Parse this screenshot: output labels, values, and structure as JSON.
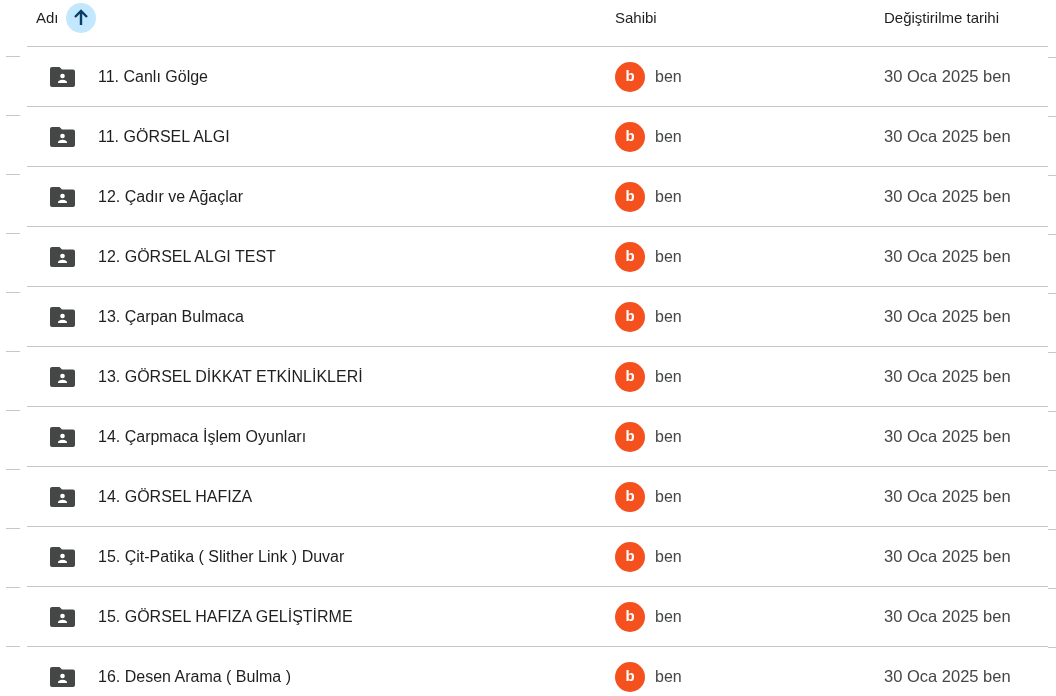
{
  "columns": [
    {
      "label": "Adı",
      "sorted": true
    },
    {
      "label": "Sahibi",
      "sorted": false
    },
    {
      "label": "Değiştirilme tarihi",
      "sorted": false
    }
  ],
  "rows": [
    {
      "name": "11. Canlı Gölge",
      "owner_initial": "b",
      "owner": "ben",
      "modified": "30 Oca 2025 ben"
    },
    {
      "name": "11. GÖRSEL ALGI",
      "owner_initial": "b",
      "owner": "ben",
      "modified": "30 Oca 2025 ben"
    },
    {
      "name": "12. Çadır ve Ağaçlar",
      "owner_initial": "b",
      "owner": "ben",
      "modified": "30 Oca 2025 ben"
    },
    {
      "name": "12. GÖRSEL ALGI TEST",
      "owner_initial": "b",
      "owner": "ben",
      "modified": "30 Oca 2025 ben"
    },
    {
      "name": "13. Çarpan Bulmaca",
      "owner_initial": "b",
      "owner": "ben",
      "modified": "30 Oca 2025 ben"
    },
    {
      "name": "13. GÖRSEL DİKKAT ETKİNLİKLERİ",
      "owner_initial": "b",
      "owner": "ben",
      "modified": "30 Oca 2025 ben"
    },
    {
      "name": "14. Çarpmaca İşlem Oyunları",
      "owner_initial": "b",
      "owner": "ben",
      "modified": "30 Oca 2025 ben"
    },
    {
      "name": "14. GÖRSEL HAFIZA",
      "owner_initial": "b",
      "owner": "ben",
      "modified": "30 Oca 2025 ben"
    },
    {
      "name": "15. Çit-Patika ( Slither Link ) Duvar",
      "owner_initial": "b",
      "owner": "ben",
      "modified": "30 Oca 2025 ben"
    },
    {
      "name": "15. GÖRSEL HAFIZA GELİŞTİRME",
      "owner_initial": "b",
      "owner": "ben",
      "modified": "30 Oca 2025 ben"
    },
    {
      "name": "16. Desen Arama ( Bulma )",
      "owner_initial": "b",
      "owner": "ben",
      "modified": "30 Oca 2025 ben"
    }
  ]
}
